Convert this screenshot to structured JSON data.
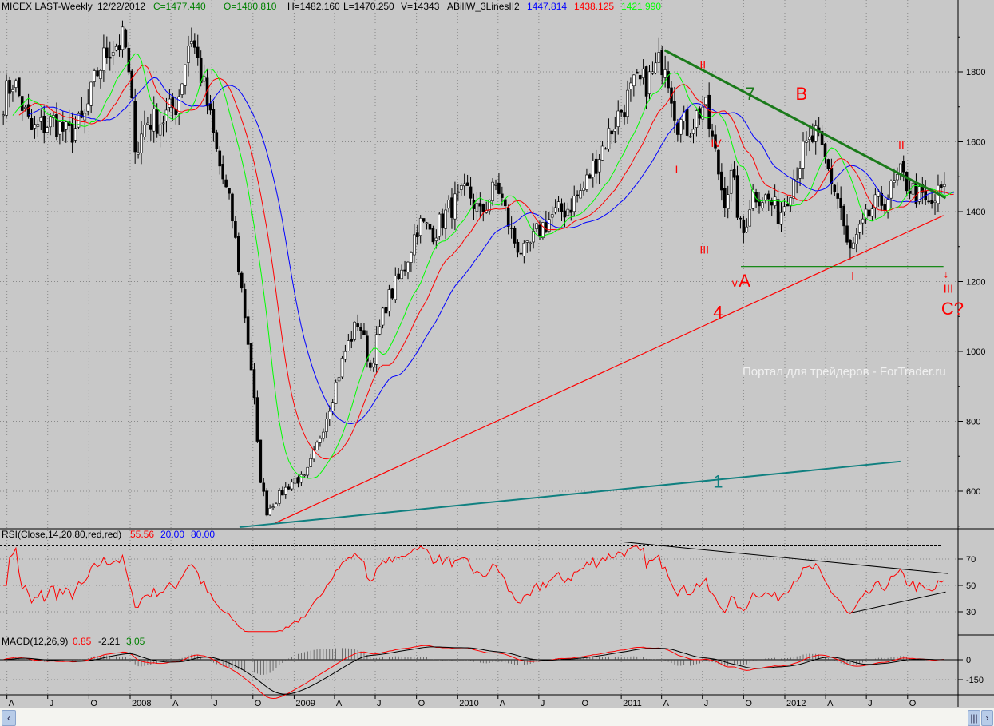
{
  "header": {
    "symbol": "MICEX LAST-Weekly",
    "date": "12/22/2012",
    "close": "C=1477.440",
    "open": "O=1480.810",
    "high": "H=1482.160",
    "low": "L=1470.250",
    "volume": "V=14343",
    "indicator": "ABillW_3LinesII2",
    "ma_blue": "1447.814",
    "ma_red": "1438.125",
    "ma_green": "1421.990"
  },
  "rsi_legend": {
    "name": "RSI(Close,14,20,80,red,red)",
    "value": "55.56",
    "low": "20.00",
    "high": "80.00"
  },
  "macd_legend": {
    "name": "MACD(12,26,9)",
    "macd": "0.85",
    "signal": "-2.21",
    "hist": "3.05"
  },
  "watermark": "Портал для трейдеров - ForTrader.ru",
  "colors": {
    "bg": "#c8c8c8",
    "ma_blue": "#0000ff",
    "ma_red": "#ff0000",
    "ma_green": "#00ff00",
    "trend_green": "#1a7a1a",
    "trend_red": "#ff0000",
    "trend_teal": "#108080",
    "annot": "#ff0000"
  },
  "chart_data": {
    "type": "candlestick",
    "interval": "weekly",
    "price_ticks": [
      600,
      800,
      1000,
      1200,
      1400,
      1600,
      1800
    ],
    "rsi_ticks": [
      30,
      50,
      70
    ],
    "rsi_levels": [
      20,
      80
    ],
    "macd_ticks": [
      0,
      -150
    ],
    "x_ticks": [
      [
        "A",
        "2007-04-01"
      ],
      [
        "J",
        "2007-07-01"
      ],
      [
        "O",
        "2007-10-01"
      ],
      [
        "2008",
        "2008-01-01"
      ],
      [
        "A",
        "2008-04-01"
      ],
      [
        "J",
        "2008-07-01"
      ],
      [
        "O",
        "2008-10-01"
      ],
      [
        "2009",
        "2009-01-01"
      ],
      [
        "A",
        "2009-04-01"
      ],
      [
        "J",
        "2009-07-01"
      ],
      [
        "O",
        "2009-10-01"
      ],
      [
        "2010",
        "2010-01-01"
      ],
      [
        "A",
        "2010-04-01"
      ],
      [
        "J",
        "2010-07-01"
      ],
      [
        "O",
        "2010-10-01"
      ],
      [
        "2011",
        "2011-01-01"
      ],
      [
        "A",
        "2011-04-01"
      ],
      [
        "J",
        "2011-07-01"
      ],
      [
        "O",
        "2011-10-01"
      ],
      [
        "2012",
        "2012-01-01"
      ],
      [
        "A",
        "2012-04-01"
      ],
      [
        "J",
        "2012-07-01"
      ],
      [
        "O",
        "2012-10-01"
      ]
    ],
    "approx_closes": [
      [
        "2007-03-24",
        1720
      ],
      [
        "2007-04-15",
        1777
      ],
      [
        "2007-05-25",
        1630
      ],
      [
        "2007-07-15",
        1660
      ],
      [
        "2007-08-15",
        1617
      ],
      [
        "2007-09-20",
        1660
      ],
      [
        "2007-10-20",
        1800
      ],
      [
        "2007-11-15",
        1870
      ],
      [
        "2007-12-20",
        1890
      ],
      [
        "2008-01-15",
        1570
      ],
      [
        "2008-02-05",
        1660
      ],
      [
        "2008-03-10",
        1660
      ],
      [
        "2008-04-15",
        1710
      ],
      [
        "2008-05-15",
        1915
      ],
      [
        "2008-06-10",
        1777
      ],
      [
        "2008-07-15",
        1550
      ],
      [
        "2008-08-15",
        1390
      ],
      [
        "2008-09-10",
        1137
      ],
      [
        "2008-10-01",
        909
      ],
      [
        "2008-10-15",
        657
      ],
      [
        "2008-11-01",
        543
      ],
      [
        "2008-12-01",
        590
      ],
      [
        "2009-01-01",
        634
      ],
      [
        "2009-01-25",
        634
      ],
      [
        "2009-02-20",
        726
      ],
      [
        "2009-03-25",
        863
      ],
      [
        "2009-04-25",
        1000
      ],
      [
        "2009-05-25",
        1091
      ],
      [
        "2009-06-20",
        954
      ],
      [
        "2009-07-25",
        1137
      ],
      [
        "2009-09-01",
        1229
      ],
      [
        "2009-10-05",
        1366
      ],
      [
        "2009-11-10",
        1343
      ],
      [
        "2009-12-15",
        1411
      ],
      [
        "2010-01-25",
        1457
      ],
      [
        "2010-02-20",
        1389
      ],
      [
        "2010-03-30",
        1480
      ],
      [
        "2010-05-05",
        1320
      ],
      [
        "2010-06-01",
        1274
      ],
      [
        "2010-06-28",
        1343
      ],
      [
        "2010-08-01",
        1389
      ],
      [
        "2010-09-05",
        1411
      ],
      [
        "2010-10-10",
        1469
      ],
      [
        "2010-11-15",
        1571
      ],
      [
        "2010-12-20",
        1663
      ],
      [
        "2011-01-28",
        1754
      ],
      [
        "2011-03-05",
        1777
      ],
      [
        "2011-04-08",
        1846
      ],
      [
        "2011-05-05",
        1663
      ],
      [
        "2011-06-01",
        1640
      ],
      [
        "2011-07-05",
        1709
      ],
      [
        "2011-08-01",
        1549
      ],
      [
        "2011-08-18",
        1434
      ],
      [
        "2011-09-05",
        1503
      ],
      [
        "2011-09-28",
        1320
      ],
      [
        "2011-10-20",
        1457
      ],
      [
        "2011-11-25",
        1434
      ],
      [
        "2011-12-20",
        1389
      ],
      [
        "2012-01-15",
        1480
      ],
      [
        "2012-02-12",
        1571
      ],
      [
        "2012-03-10",
        1617
      ],
      [
        "2012-04-05",
        1526
      ],
      [
        "2012-05-05",
        1411
      ],
      [
        "2012-05-22",
        1274
      ],
      [
        "2012-06-18",
        1343
      ],
      [
        "2012-07-15",
        1411
      ],
      [
        "2012-08-12",
        1434
      ],
      [
        "2012-09-15",
        1503
      ],
      [
        "2012-10-15",
        1457
      ],
      [
        "2012-11-20",
        1411
      ],
      [
        "2012-12-22",
        1477
      ]
    ],
    "trendlines": [
      {
        "label": "7",
        "color": "#1a7a1a",
        "from": [
          "2011-04-08",
          1862
        ],
        "to": [
          "2012-12-25",
          1439
        ]
      },
      {
        "label": "4",
        "color": "#ff0000",
        "from": [
          "2008-11-20",
          509
        ],
        "to": [
          "2012-12-20",
          1389
        ]
      },
      {
        "label": "1",
        "color": "#108080",
        "from": [
          "2008-09-01",
          497
        ],
        "to": [
          "2012-09-15",
          685
        ]
      },
      {
        "label": "",
        "color": "#008000",
        "from": [
          "2011-09-25",
          1243
        ],
        "to": [
          "2012-12-20",
          1243
        ]
      }
    ],
    "rsi_trendlines": [
      {
        "from": [
          "2011-01-05",
          83
        ],
        "to": [
          "2012-12-30",
          59
        ]
      },
      {
        "from": [
          "2012-05-25",
          29
        ],
        "to": [
          "2012-12-25",
          45
        ]
      }
    ],
    "annotations": [
      {
        "text": "II",
        "date": "2011-06-25",
        "price": 1810,
        "size": 14
      },
      {
        "text": "B",
        "date": "2012-01-25",
        "price": 1720,
        "size": 22
      },
      {
        "text": "IV",
        "date": "2011-07-20",
        "price": 1585,
        "size": 14
      },
      {
        "text": "I",
        "date": "2011-05-01",
        "price": 1510,
        "size": 14
      },
      {
        "text": "III",
        "date": "2011-06-25",
        "price": 1280,
        "size": 14
      },
      {
        "text": "v",
        "date": "2011-09-05",
        "price": 1185,
        "size": 14
      },
      {
        "text": "A",
        "date": "2011-09-20",
        "price": 1185,
        "size": 22
      },
      {
        "text": "4",
        "date": "2011-07-25",
        "price": 1095,
        "size": 22
      },
      {
        "text": "I",
        "date": "2012-05-28",
        "price": 1205,
        "size": 14
      },
      {
        "text": "II",
        "date": "2012-09-10",
        "price": 1580,
        "size": 14
      },
      {
        "text": "↓",
        "date": "2012-12-20",
        "price": 1212,
        "size": 13
      },
      {
        "text": "III",
        "date": "2012-12-20",
        "price": 1168,
        "size": 15
      },
      {
        "text": "C?",
        "date": "2012-12-15",
        "price": 1105,
        "size": 22
      },
      {
        "text": "1",
        "date": "2011-07-25",
        "price": 610,
        "size": 22,
        "color": "#108080"
      },
      {
        "text": "7",
        "date": "2011-10-05",
        "price": 1720,
        "size": 22,
        "color": "#1a7a1a"
      }
    ]
  }
}
